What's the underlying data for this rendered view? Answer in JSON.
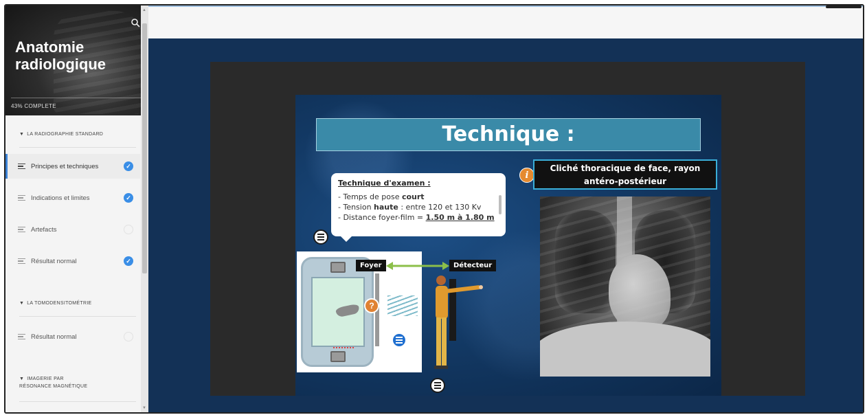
{
  "course": {
    "title": "Anatomie radiologique",
    "progress_text": "43% COMPLETE"
  },
  "sidebar": {
    "sections": [
      {
        "label": "LA RADIOGRAPHIE STANDARD",
        "items": [
          {
            "label": "Principes et techniques",
            "status": "complete",
            "active": true
          },
          {
            "label": "Indications et limites",
            "status": "complete",
            "active": false
          },
          {
            "label": "Artefacts",
            "status": "incomplete",
            "active": false
          },
          {
            "label": "Résultat normal",
            "status": "complete",
            "active": false
          }
        ]
      },
      {
        "label": "LA TOMODENSITOMÉTRIE",
        "items": [
          {
            "label": "Résultat normal",
            "status": "incomplete",
            "active": false
          }
        ]
      },
      {
        "label": "IMAGERIE PAR RÉSONANCE MAGNÉTIQUE",
        "items": []
      }
    ]
  },
  "slide": {
    "title": "Technique :",
    "exam_box": {
      "heading": "Technique d'examen :",
      "line1_prefix": "- Temps de pose ",
      "line1_bold": "court",
      "line2_prefix": "- Tension ",
      "line2_bold": "haute",
      "line2_suffix": " : entre 120 et 130 Kv",
      "line3_prefix": "- Distance foyer-film = ",
      "line3_bold": "1.50 m à 1.80 m"
    },
    "labels": {
      "foyer": "Foyer",
      "detecteur": "Détecteur"
    },
    "question_mark": "?",
    "info_glyph": "i",
    "info_title": "Cliché thoracique de face, rayon antéro-postérieur"
  },
  "colors": {
    "accent_blue": "#3a8ee6",
    "stage_bg": "#133156",
    "banner": "#3a8aa8",
    "orange": "#e08233"
  }
}
